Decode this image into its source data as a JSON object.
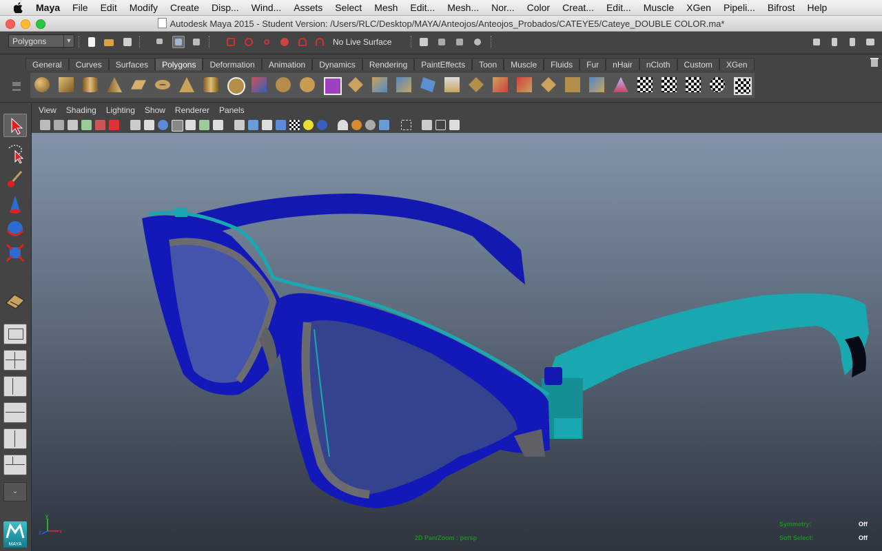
{
  "menubar": {
    "app": "Maya",
    "items": [
      "File",
      "Edit",
      "Modify",
      "Create",
      "Disp...",
      "Wind...",
      "Assets",
      "Select",
      "Mesh",
      "Edit...",
      "Mesh...",
      "Nor...",
      "Color",
      "Creat...",
      "Edit...",
      "Muscle",
      "XGen",
      "Pipeli...",
      "Bifrost",
      "Help"
    ]
  },
  "window": {
    "title": "Autodesk Maya 2015 - Student Version: /Users/RLC/Desktop/MAYA/Anteojos/Anteojos_Probados/CATEYE5/Cateye_DOUBLE COLOR.ma*"
  },
  "statusline": {
    "mode": "Polygons",
    "live_surface": "No Live Surface"
  },
  "shelf": {
    "tabs": [
      "General",
      "Curves",
      "Surfaces",
      "Polygons",
      "Deformation",
      "Animation",
      "Dynamics",
      "Rendering",
      "PaintEffects",
      "Toon",
      "Muscle",
      "Fluids",
      "Fur",
      "nHair",
      "nCloth",
      "Custom",
      "XGen"
    ],
    "active_tab": "Polygons",
    "icon_count_visible": 31
  },
  "panel": {
    "menus": [
      "View",
      "Shading",
      "Lighting",
      "Show",
      "Renderer",
      "Panels"
    ]
  },
  "viewport": {
    "camera_hud": "2D Pan/Zoom : persp",
    "symmetry_label": "Symmetry:",
    "symmetry_value": "Off",
    "soft_select_label": "Soft Select:",
    "soft_select_value": "Off",
    "axis_y": "y",
    "axis_x": "x",
    "axis_z": "z",
    "colors": {
      "frame": "#1a1aa8",
      "accent": "#1aa8a8",
      "inner": "#6f6f72"
    }
  },
  "logo_text": "MAYA"
}
